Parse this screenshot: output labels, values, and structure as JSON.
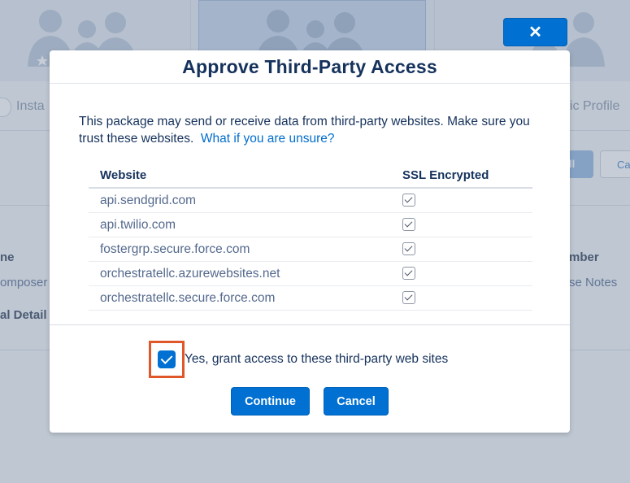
{
  "background": {
    "left_tab_label": "Insta",
    "right_tab_label": "ific Profile",
    "install_button": "all",
    "cancel_button": "Ca",
    "left_field_header": "ne",
    "left_field_value": "omposer",
    "left_section": "al Detail",
    "right_field_header": "mber",
    "right_field_value": "se Notes"
  },
  "close_button": {
    "icon": "close-icon",
    "label": "✕"
  },
  "modal": {
    "title": "Approve Third-Party Access",
    "description": "This package may send or receive data from third-party websites. Make sure you trust these websites.",
    "help_link": "What if you are unsure?",
    "table": {
      "columns": [
        "Website",
        "SSL Encrypted"
      ],
      "rows": [
        {
          "website": "api.sendgrid.com",
          "ssl": true
        },
        {
          "website": "api.twilio.com",
          "ssl": true
        },
        {
          "website": "fostergrp.secure.force.com",
          "ssl": true
        },
        {
          "website": "orchestratellc.azurewebsites.net",
          "ssl": true
        },
        {
          "website": "orchestratellc.secure.force.com",
          "ssl": true
        }
      ]
    },
    "consent": {
      "label": "Yes, grant access to these third-party web sites",
      "checked": true
    },
    "buttons": {
      "continue": "Continue",
      "cancel": "Cancel"
    }
  },
  "colors": {
    "brand": "#0070d2",
    "title": "#16325c",
    "highlight": "#e0582a"
  }
}
